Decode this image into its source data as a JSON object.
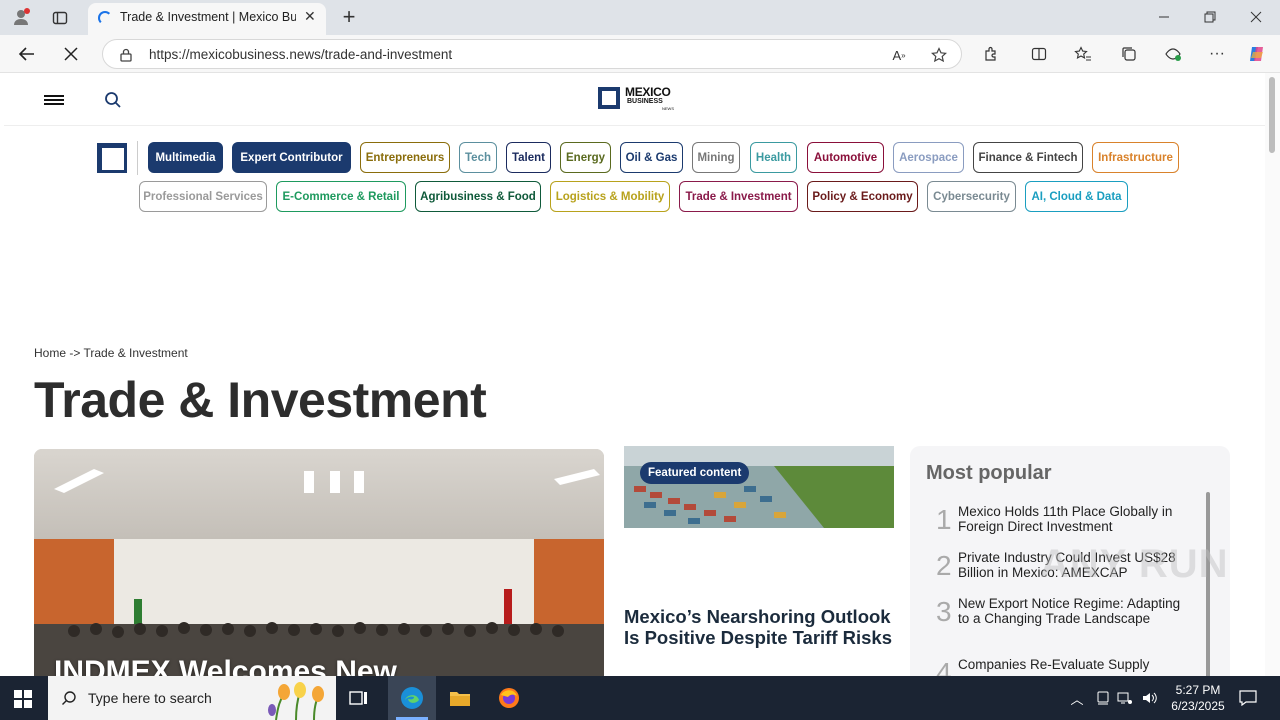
{
  "browser": {
    "tab_title": "Trade & Investment | Mexico Business",
    "url": "https://mexicobusiness.news/trade-and-investment",
    "new_tab_label": "+"
  },
  "site": {
    "logo_line1": "MEXICO",
    "logo_line2": "BUSINESS",
    "logo_line3": "NEWS"
  },
  "categories_row1": [
    {
      "label": "Multimedia",
      "color": "#1b3a6e",
      "filled": true
    },
    {
      "label": "Expert Contributor",
      "color": "#1b3a6e",
      "filled": true
    },
    {
      "label": "Entrepreneurs",
      "color": "#8a6d0b"
    },
    {
      "label": "Tech",
      "color": "#5b8f9e"
    },
    {
      "label": "Talent",
      "color": "#1b2b5e"
    },
    {
      "label": "Energy",
      "color": "#5a6a1f"
    },
    {
      "label": "Oil & Gas",
      "color": "#1b3a6e"
    },
    {
      "label": "Mining",
      "color": "#777777"
    },
    {
      "label": "Health",
      "color": "#3a9aa0"
    },
    {
      "label": "Automotive",
      "color": "#8a0f3a"
    },
    {
      "label": "Aerospace",
      "color": "#8a9cc0"
    },
    {
      "label": "Finance & Fintech",
      "color": "#444444"
    },
    {
      "label": "Infrastructure",
      "color": "#d9822b"
    }
  ],
  "categories_row2": [
    {
      "label": "Professional Services",
      "color": "#9a9a9a"
    },
    {
      "label": "E-Commerce & Retail",
      "color": "#1e9a5e"
    },
    {
      "label": "Agribusiness & Food",
      "color": "#0f5a3a"
    },
    {
      "label": "Logistics & Mobility",
      "color": "#b8a21c"
    },
    {
      "label": "Trade & Investment",
      "color": "#8a1a4a"
    },
    {
      "label": "Policy & Economy",
      "color": "#6a1a1a"
    },
    {
      "label": "Cybersecurity",
      "color": "#7a8a92"
    },
    {
      "label": "AI, Cloud & Data",
      "color": "#1a9ec0"
    }
  ],
  "breadcrumb": "Home -> Trade & Investment",
  "page_title": "Trade & Investment",
  "hero": {
    "headline": "INDMEX Welcomes New"
  },
  "featured": {
    "badge": "Featured content",
    "title": "Mexico’s Nearshoring Outlook Is Positive Despite Tariff Risks"
  },
  "most_popular": {
    "heading": "Most popular",
    "items": [
      {
        "num": "1",
        "text": "Mexico Holds 11th Place Globally in Foreign Direct Investment"
      },
      {
        "num": "2",
        "text": "Private Industry Could Invest US$28 Billion in Mexico: AMEXCAP"
      },
      {
        "num": "3",
        "text": "New Export Notice Regime: Adapting to a Changing Trade Landscape"
      },
      {
        "num": "4",
        "text": "Companies Re-Evaluate Supply"
      }
    ]
  },
  "taskbar": {
    "search_placeholder": "Type here to search",
    "time": "5:27 PM",
    "date": "6/23/2025"
  },
  "watermark": "ANY RUN"
}
